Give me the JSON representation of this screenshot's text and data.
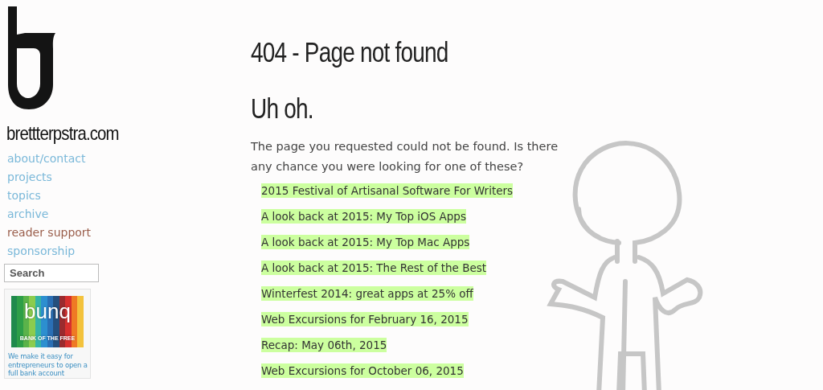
{
  "site": {
    "title": "brettterpstra.com"
  },
  "nav": [
    {
      "label": "about/contact",
      "kind": "link"
    },
    {
      "label": "projects",
      "kind": "link"
    },
    {
      "label": "topics",
      "kind": "link"
    },
    {
      "label": "archive",
      "kind": "link"
    },
    {
      "label": "reader support",
      "kind": "support"
    },
    {
      "label": "sponsorship",
      "kind": "link"
    }
  ],
  "search": {
    "placeholder": "Search"
  },
  "sponsor": {
    "brand": "bunq",
    "tagline": "BANK OF THE FREE",
    "text": "We make it easy for entrepreneurs to open a full bank account"
  },
  "heading": "404 - Page not found",
  "subheading": "Uh oh.",
  "message": "The page you requested could not be found. Is there any chance you were looking for one of these?",
  "suggestions": [
    "2015 Festival of Artisanal Software For Writers",
    "A look back at 2015: My Top iOS Apps",
    "A look back at 2015: My Top Mac Apps",
    "A look back at 2015: The Rest of the Best",
    "Winterfest 2014: great apps at 25% off",
    "Web Excursions for February 16, 2015",
    "Recap: May 06th, 2015",
    "Web Excursions for October 06, 2015"
  ]
}
